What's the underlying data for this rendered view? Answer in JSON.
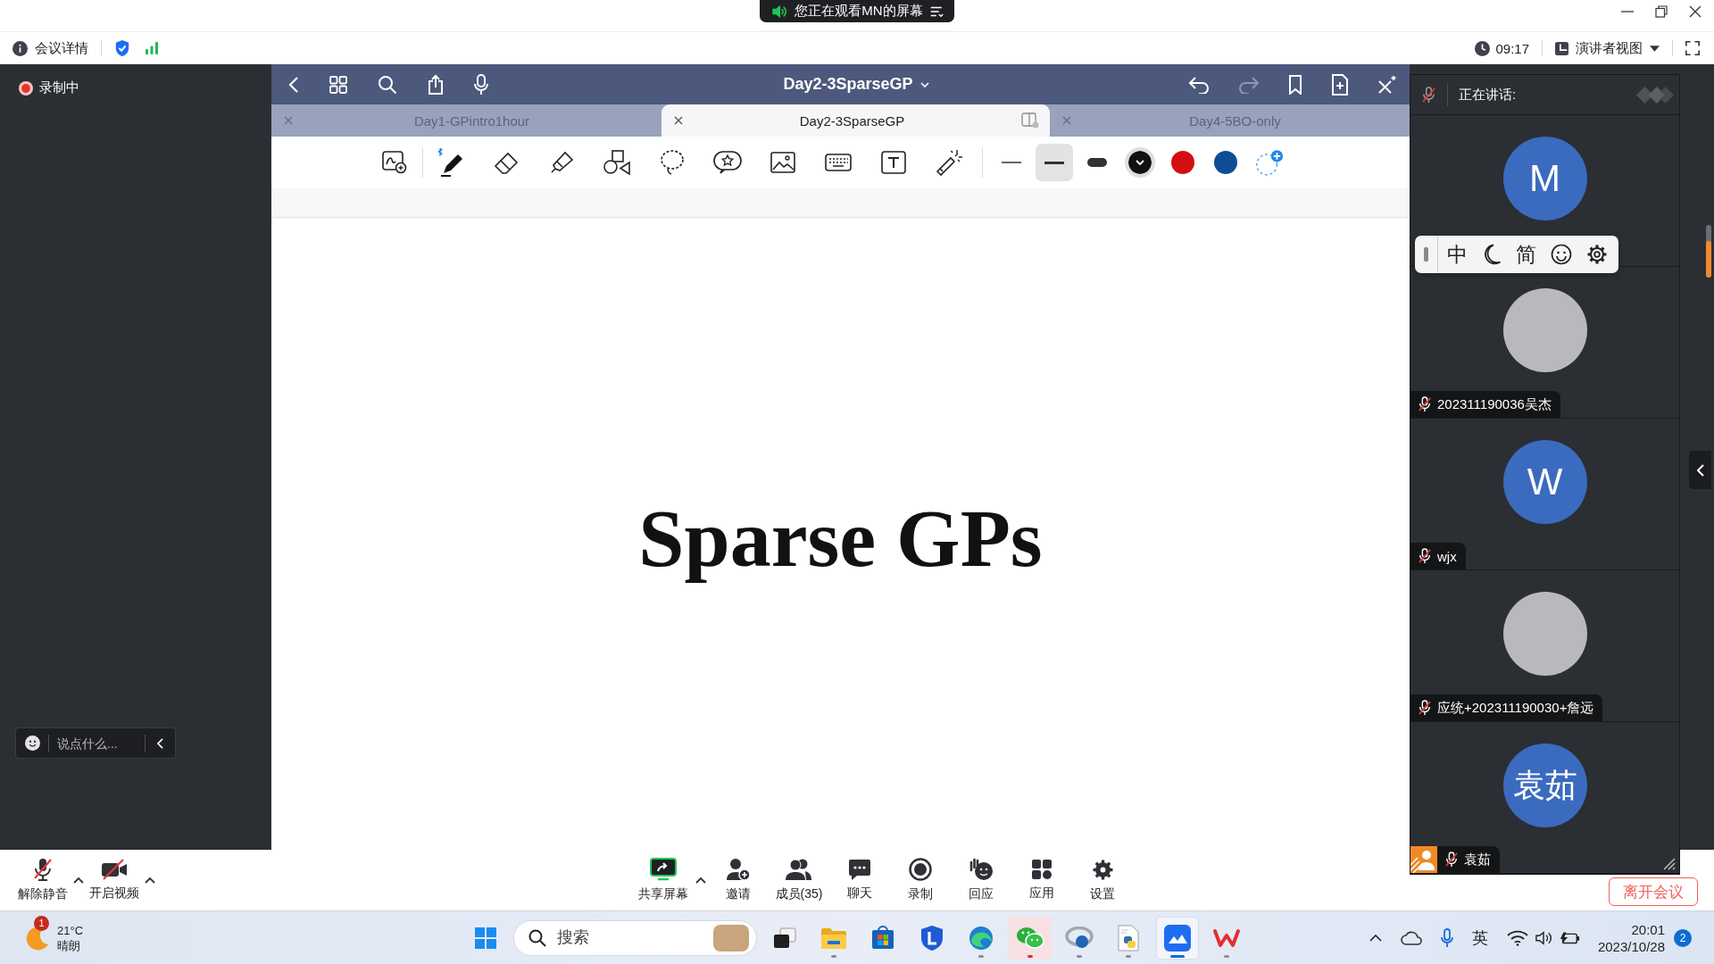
{
  "title_bar": {
    "banner": "您正在观看MN的屏幕"
  },
  "info_bar": {
    "meeting_details": "会议详情",
    "elapsed_time": "09:17",
    "view_mode": "演讲者视图"
  },
  "left_panel": {
    "recording": "录制中",
    "chat_input": {
      "placeholder": "说点什么..."
    }
  },
  "document": {
    "title": "Day2-3SparseGP",
    "tabs": [
      {
        "label": "Day1-GPintro1hour",
        "selected": false
      },
      {
        "label": "Day2-3SparseGP",
        "selected": true
      },
      {
        "label": "Day4-5BO-only",
        "selected": false
      }
    ],
    "stroke_widths": [
      {
        "kind": "thin",
        "selected": false
      },
      {
        "kind": "medium",
        "selected": true
      },
      {
        "kind": "thick",
        "selected": false
      }
    ],
    "colors": [
      {
        "color": "#111111",
        "selected": true
      },
      {
        "color": "#d40f14",
        "selected": false
      },
      {
        "color": "#0d4d98",
        "selected": false
      }
    ],
    "page_heading": "Sparse GPs"
  },
  "participants": {
    "header": "正在讲话:",
    "tiles": [
      {
        "kind": "initials",
        "avatar_text": "M",
        "presenter": false
      },
      {
        "kind": "photo",
        "name": "202311190036吴杰",
        "muted": true,
        "presenter": false
      },
      {
        "kind": "initials",
        "avatar_text": "W",
        "name": "wjx",
        "muted": true,
        "presenter": false
      },
      {
        "kind": "photo",
        "name": "应统+202311190030+詹远",
        "muted": true,
        "presenter": false
      },
      {
        "kind": "initials",
        "avatar_text": "袁茹",
        "name": "袁茹",
        "muted": true,
        "presenter": true
      }
    ]
  },
  "ime_bar": {
    "mode": "中",
    "script": "简"
  },
  "meeting_toolbar": {
    "left": [
      {
        "kind": "mic-off",
        "label": "解除静音",
        "menu": true
      },
      {
        "kind": "camera-off",
        "label": "开启视频",
        "menu": true
      }
    ],
    "center": [
      {
        "kind": "share-screen",
        "label": "共享屏幕",
        "menu": true
      },
      {
        "kind": "invite",
        "label": "邀请",
        "menu": false
      },
      {
        "kind": "members",
        "label": "成员(35)",
        "menu": false
      },
      {
        "kind": "chat",
        "label": "聊天",
        "menu": false
      },
      {
        "kind": "record",
        "label": "录制",
        "menu": false
      },
      {
        "kind": "react",
        "label": "回应",
        "menu": false
      },
      {
        "kind": "apps",
        "label": "应用",
        "menu": false
      },
      {
        "kind": "settings",
        "label": "设置",
        "menu": false
      }
    ],
    "leave": "离开会议"
  },
  "taskbar": {
    "weather": {
      "badge": "1",
      "temperature": "21°C",
      "condition": "晴朗"
    },
    "search": {
      "placeholder": "搜索"
    },
    "apps": [
      {
        "kind": "task-view",
        "running": false,
        "selected": false,
        "attention": false
      },
      {
        "kind": "folder",
        "running": true,
        "selected": false,
        "attention": false
      },
      {
        "kind": "store",
        "running": false,
        "selected": false,
        "attention": false
      },
      {
        "kind": "shield",
        "running": false,
        "selected": false,
        "attention": false
      },
      {
        "kind": "browser",
        "running": true,
        "selected": false,
        "attention": false
      },
      {
        "kind": "chat",
        "running": true,
        "selected": false,
        "attention": true
      },
      {
        "kind": "ring",
        "running": true,
        "selected": false,
        "attention": false
      },
      {
        "kind": "script",
        "running": true,
        "selected": false,
        "attention": false
      },
      {
        "kind": "mountain",
        "running": true,
        "selected": true,
        "attention": false
      },
      {
        "kind": "zigzag",
        "running": true,
        "selected": false,
        "attention": false
      }
    ],
    "input_language": "英",
    "time": "20:01",
    "date": "2023/10/28",
    "notifications": "2"
  }
}
